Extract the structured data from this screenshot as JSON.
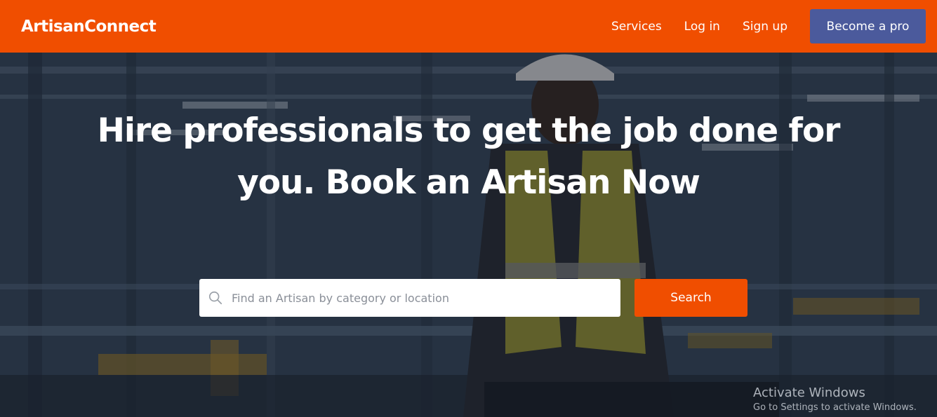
{
  "navbar": {
    "brand": "ArtisanConnect",
    "links": [
      "Services",
      "Log in",
      "Sign up"
    ],
    "cta_label": "Become a pro",
    "colors": {
      "bar": "#f04e00",
      "cta": "#4b5a9c"
    }
  },
  "hero": {
    "headline_line1": "Hire professionals to get the job done for",
    "headline_line2": "you. Book an Artisan Now",
    "search": {
      "placeholder": "Find an Artisan by category or location",
      "value": "",
      "icon": "search-icon",
      "button_label": "Search"
    },
    "background_image": "factory worker in hard hat and safety vest"
  },
  "os_watermark": {
    "title": "Activate Windows",
    "subtitle": "Go to Settings to activate Windows."
  }
}
